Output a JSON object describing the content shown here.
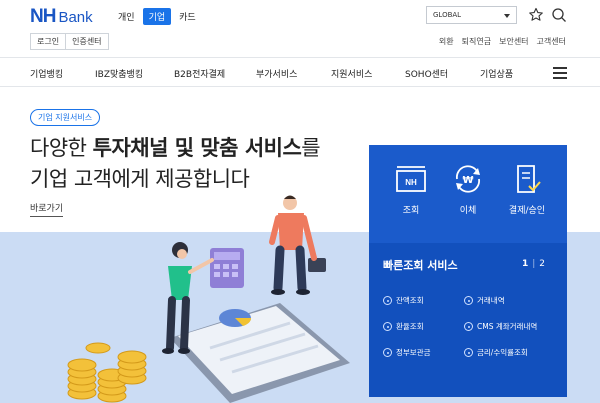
{
  "logo": {
    "nh": "NH",
    "bank": "Bank"
  },
  "segment_tabs": [
    {
      "label": "개인",
      "active": false
    },
    {
      "label": "기업",
      "active": true
    },
    {
      "label": "카드",
      "active": false
    }
  ],
  "auth": {
    "login": "로그인",
    "cert": "인증센터"
  },
  "language_select": {
    "value": "GLOBAL"
  },
  "utility_links": [
    "외환",
    "퇴직연금",
    "보안센터",
    "고객센터"
  ],
  "gnb": [
    "기업뱅킹",
    "IBZ맞춤뱅킹",
    "B2B전자결제",
    "부가서비스",
    "지원서비스",
    "SOHO센터",
    "기업상품"
  ],
  "hero": {
    "badge": "기업 지원서비스",
    "line1_plain": "다양한 ",
    "line1_bold": "투자채널 및 맞춤 서비스",
    "line1_tail": "를",
    "line2": "기업 고객에게 제공합니다",
    "more": "바로가기"
  },
  "services": [
    {
      "label": "조회",
      "icon": "inquiry-icon",
      "icon_text": "NH"
    },
    {
      "label": "이체",
      "icon": "transfer-icon",
      "icon_text": "₩"
    },
    {
      "label": "결제/승인",
      "icon": "approval-icon"
    }
  ],
  "quick": {
    "title": "빠른조회 서비스",
    "page_current": "1",
    "page_total": "2",
    "links": [
      "잔액조회",
      "거래내역",
      "환율조회",
      "CMS 계좌거래내역",
      "정부보관금",
      "금리/수익률조회"
    ]
  },
  "colors": {
    "brand": "#1a56c4",
    "accent": "#1a73e8",
    "service_box": "#1b5bcb",
    "hero_floor": "#cbdcf4"
  }
}
